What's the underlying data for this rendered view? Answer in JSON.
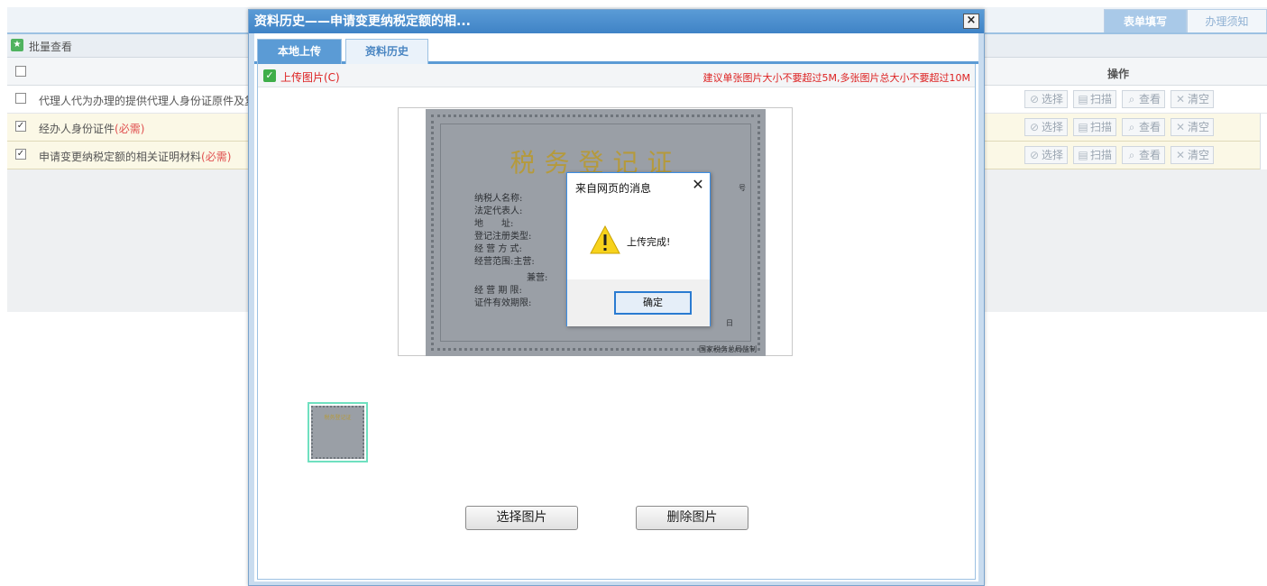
{
  "background": {
    "tabs": {
      "form_fill": "表单填写",
      "instructions": "办理须知"
    },
    "batch_view": "批量查看",
    "ops_header": "操作",
    "rows": [
      {
        "label": "代理人代为办理的提供代理人身份证原件及复",
        "required": "",
        "checked": false
      },
      {
        "label": "经办人身份证件",
        "required": "(必需)",
        "checked": true
      },
      {
        "label": "申请变更纳税定额的相关证明材料",
        "required": "(必需)",
        "checked": true
      }
    ],
    "ops": {
      "select": "选择",
      "scan": "扫描",
      "view": "查看",
      "clear": "清空"
    }
  },
  "dialog": {
    "title": "资料历史——申请变更纳税定额的相...",
    "close_symbol": "×",
    "tabs": {
      "local_upload": "本地上传",
      "history": "资料历史"
    },
    "upload_label": "上传图片(C)",
    "size_tip": "建议单张图片大小不要超过5M,多张图片总大小不要超过10M",
    "certificate": {
      "title": "税务登记证",
      "fields": [
        "纳税人名称:",
        "法定代表人:",
        "地　　址:",
        "登记注册类型:",
        "经 营 方 式:",
        "经营范围:主营:",
        "兼营:",
        "经 营 期 限:",
        "证件有效期限:"
      ],
      "issuer": "国家税务总局监制",
      "mark_h": "号",
      "mark_sm": "日"
    },
    "thumb_title": "税务登记证",
    "buttons": {
      "select_image": "选择图片",
      "delete_image": "删除图片"
    }
  },
  "message_box": {
    "title": "来自网页的消息",
    "text": "上传完成!",
    "ok": "确定",
    "close_symbol": "✕"
  }
}
